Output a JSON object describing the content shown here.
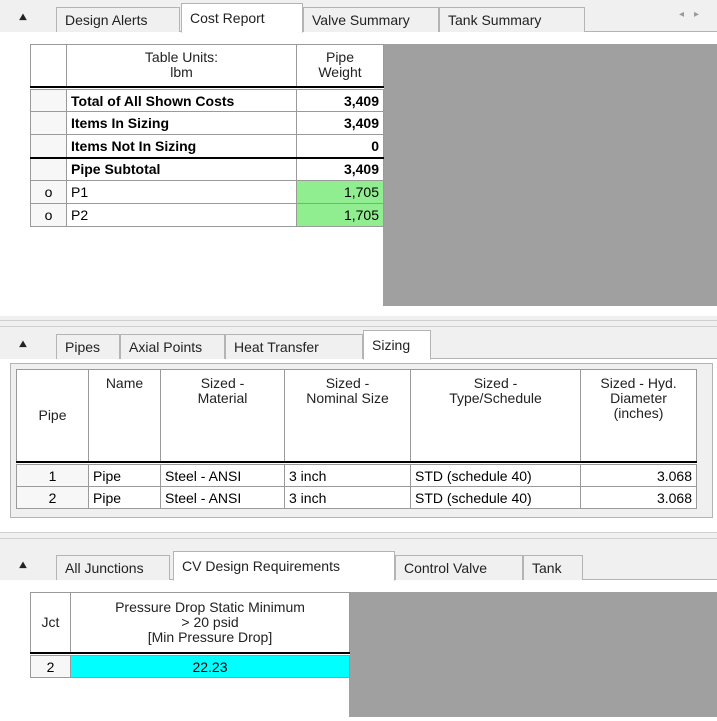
{
  "panel1": {
    "collapse_icon": "double-chevron-up-icon",
    "tabs": [
      "Design Alerts",
      "Cost Report",
      "Valve Summary",
      "Tank Summary"
    ],
    "active_tab": "Cost Report",
    "nav_left": "◂",
    "nav_right": "▸",
    "table": {
      "header_units": "Table Units:",
      "header_units_value": "lbm",
      "header_col": "Pipe Weight",
      "header_col_line1": "Pipe",
      "header_col_line2": "Weight",
      "rows": [
        {
          "marker": "",
          "label": "Total of All Shown Costs",
          "value": "3,409"
        },
        {
          "marker": "",
          "label": "Items In Sizing",
          "value": "3,409"
        },
        {
          "marker": "",
          "label": "Items Not In Sizing",
          "value": "0"
        },
        {
          "marker": "",
          "label": "Pipe Subtotal",
          "value": "3,409"
        },
        {
          "marker": "o",
          "label": "P1",
          "value": "1,705"
        },
        {
          "marker": "o",
          "label": "P2",
          "value": "1,705"
        }
      ]
    }
  },
  "panel2": {
    "collapse_icon": "double-chevron-up-icon",
    "tabs": [
      "Pipes",
      "Axial Points",
      "Heat Transfer",
      "Sizing"
    ],
    "active_tab": "Sizing",
    "table": {
      "headers": {
        "pipe": "Pipe",
        "name": "Name",
        "material_1": "Sized -",
        "material_2": "Material",
        "nominal_1": "Sized -",
        "nominal_2": "Nominal Size",
        "type_1": "Sized -",
        "type_2": "Type/Schedule",
        "diam_1": "Sized - Hyd.",
        "diam_2": "Diameter",
        "diam_3": "(inches)"
      },
      "rows": [
        {
          "pipe": "1",
          "name": "Pipe",
          "material": "Steel - ANSI",
          "nominal": "3 inch",
          "type": "STD (schedule 40)",
          "diameter": "3.068"
        },
        {
          "pipe": "2",
          "name": "Pipe",
          "material": "Steel - ANSI",
          "nominal": "3 inch",
          "type": "STD (schedule 40)",
          "diameter": "3.068"
        }
      ]
    }
  },
  "panel3": {
    "collapse_icon": "double-chevron-up-icon",
    "tabs": [
      "All Junctions",
      "CV Design Requirements",
      "Control Valve",
      "Tank"
    ],
    "active_tab": "CV Design Requirements",
    "table": {
      "header_jct": "Jct",
      "header_col_1": "Pressure Drop Static Minimum",
      "header_col_2": "> 20 psid",
      "header_col_3": "[Min Pressure Drop]",
      "rows": [
        {
          "jct": "2",
          "value": "22.23"
        }
      ]
    }
  },
  "colors": {
    "green_highlight": "#90ee90",
    "cyan_highlight": "#00ffff",
    "gray_area": "#a0a0a0"
  }
}
